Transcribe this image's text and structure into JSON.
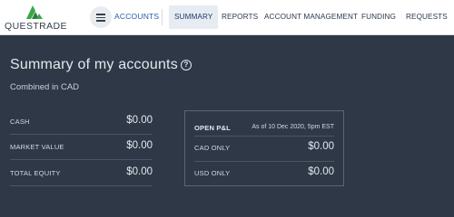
{
  "header": {
    "logo_text": "QUESTRADE",
    "accounts_label": "ACCOUNTS",
    "tabs": [
      {
        "label": "SUMMARY",
        "active": true
      },
      {
        "label": "REPORTS",
        "active": false
      },
      {
        "label": "ACCOUNT MANAGEMENT",
        "active": false
      },
      {
        "label": "FUNDING",
        "active": false
      },
      {
        "label": "REQUESTS",
        "active": false
      }
    ]
  },
  "summary": {
    "title": "Summary of my accounts",
    "subtitle": "Combined in CAD",
    "rows": [
      {
        "label": "CASH",
        "value": "$0.00"
      },
      {
        "label": "MARKET VALUE",
        "value": "$0.00"
      },
      {
        "label": "TOTAL EQUITY",
        "value": "$0.00"
      }
    ]
  },
  "open_pl": {
    "title": "OPEN P&L",
    "as_of": "As of 10 Dec 2020, 5pm EST",
    "rows": [
      {
        "label": "CAD ONLY",
        "value": "$0.00"
      },
      {
        "label": "USD ONLY",
        "value": "$0.00"
      }
    ]
  },
  "colors": {
    "background": "#2e3847",
    "accent": "#1d5ea8",
    "logo_green": "#3aa64a"
  },
  "icons": [
    "questrade-logo-icon",
    "menu-icon",
    "help-icon"
  ]
}
